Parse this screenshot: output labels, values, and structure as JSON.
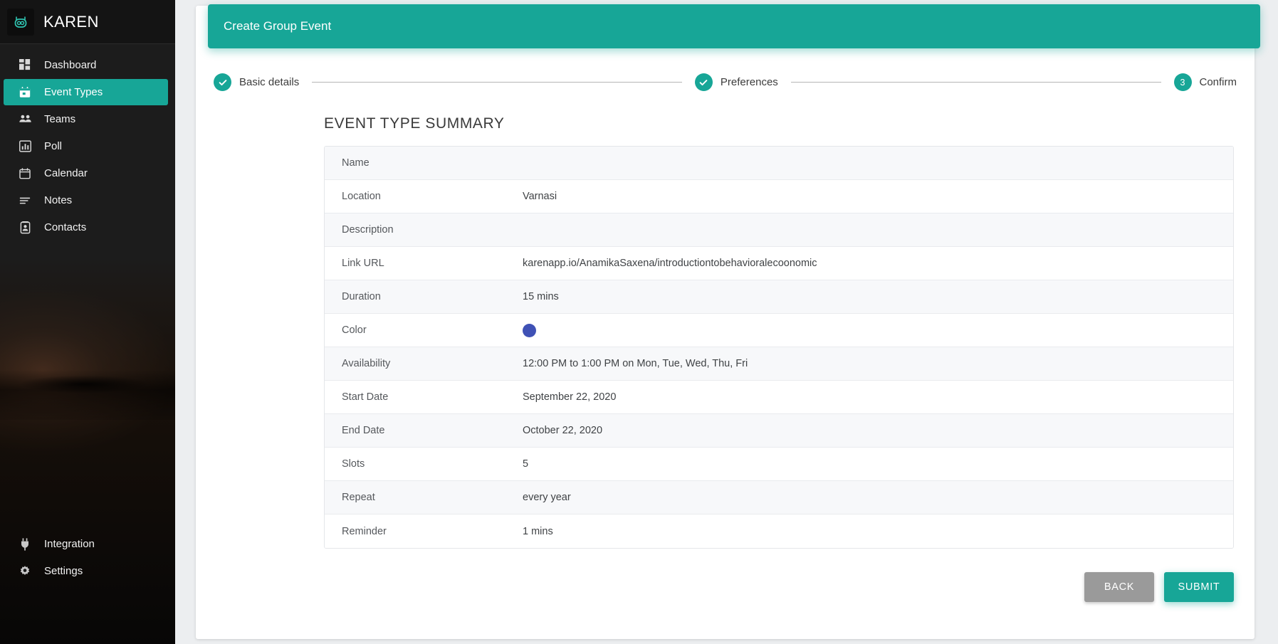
{
  "sidebar": {
    "brand": {
      "name": "KAREN",
      "logo_icon": "robot-head-icon"
    },
    "items": [
      {
        "label": "Dashboard",
        "icon": "dashboard-grid-icon",
        "active": false
      },
      {
        "label": "Event Types",
        "icon": "calendar-event-icon",
        "active": true
      },
      {
        "label": "Teams",
        "icon": "people-group-icon",
        "active": false
      },
      {
        "label": "Poll",
        "icon": "bar-chart-icon",
        "active": false
      },
      {
        "label": "Calendar",
        "icon": "calendar-icon",
        "active": false
      },
      {
        "label": "Notes",
        "icon": "lines-notes-icon",
        "active": false
      },
      {
        "label": "Contacts",
        "icon": "contact-card-icon",
        "active": false
      }
    ],
    "bottom_items": [
      {
        "label": "Integration",
        "icon": "plug-icon"
      },
      {
        "label": "Settings",
        "icon": "gear-icon"
      }
    ],
    "active_color": "#17a697"
  },
  "header": {
    "title": "Create Group Event",
    "background": "#17a697"
  },
  "stepper": {
    "steps": [
      {
        "label": "Basic details",
        "state": "complete",
        "badge": "check"
      },
      {
        "label": "Preferences",
        "state": "complete",
        "badge": "check"
      },
      {
        "label": "Confirm",
        "state": "current",
        "badge": "3"
      }
    ]
  },
  "summary": {
    "title": "EVENT TYPE SUMMARY",
    "rows": [
      {
        "key": "Name",
        "value": ""
      },
      {
        "key": "Location",
        "value": "Varnasi"
      },
      {
        "key": "Description",
        "value": ""
      },
      {
        "key": "Link URL",
        "value": "karenapp.io/AnamikaSaxena/introductiontobehavioralecoonomic"
      },
      {
        "key": "Duration",
        "value": "15 mins"
      },
      {
        "key": "Color",
        "value": "",
        "swatch": "#3f51b5"
      },
      {
        "key": "Availability",
        "value": "12:00 PM to 1:00 PM on Mon, Tue, Wed, Thu, Fri"
      },
      {
        "key": "Start Date",
        "value": "September 22, 2020"
      },
      {
        "key": "End Date",
        "value": "October 22, 2020"
      },
      {
        "key": "Slots",
        "value": "5"
      },
      {
        "key": "Repeat",
        "value": "every year"
      },
      {
        "key": "Reminder",
        "value": "1 mins"
      }
    ]
  },
  "actions": {
    "back_label": "BACK",
    "submit_label": "SUBMIT",
    "back_color": "#9a9a9a",
    "submit_color": "#17a697"
  }
}
